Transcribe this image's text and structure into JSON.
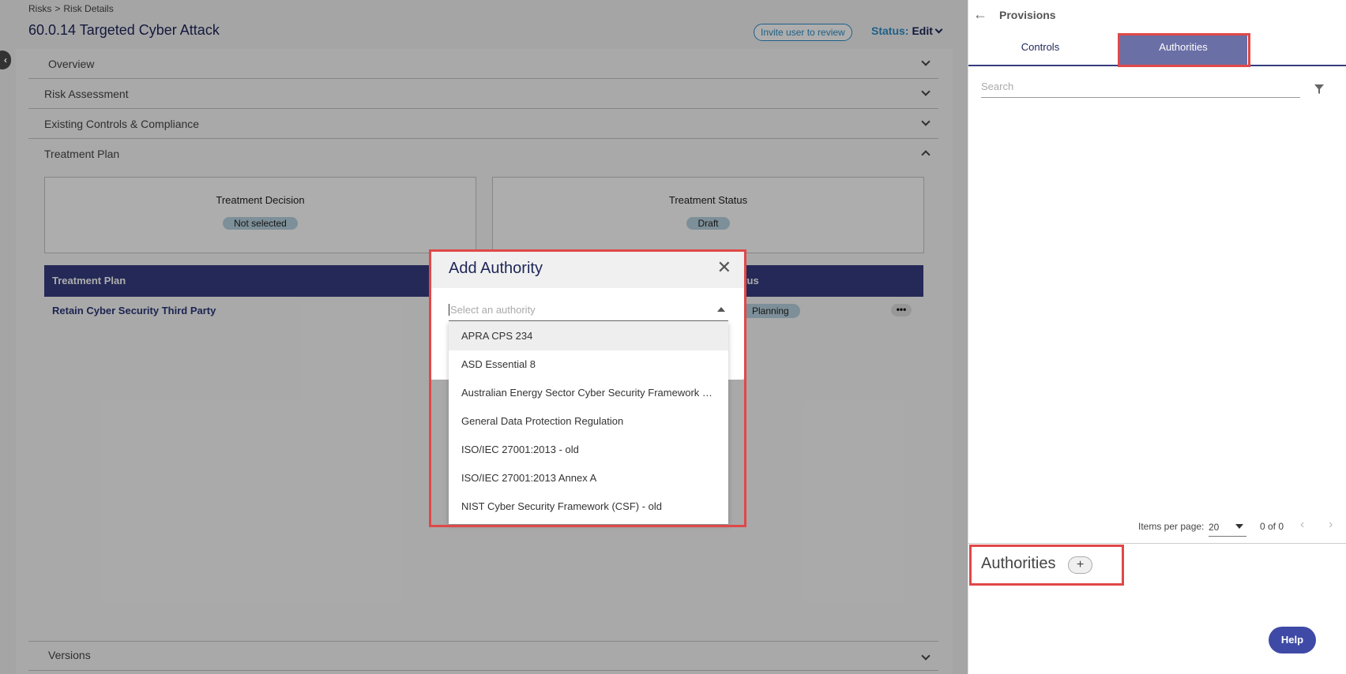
{
  "breadcrumb": {
    "root": "Risks",
    "separator": ">",
    "current": "Risk Details"
  },
  "page_title": "60.0.14 Targeted Cyber Attack",
  "invite_button": "Invite user to review",
  "status": {
    "label": "Status:",
    "value": "Edit"
  },
  "sections": {
    "overview": "Overview",
    "risk_assessment": "Risk Assessment",
    "existing_controls": "Existing Controls & Compliance",
    "treatment_plan": "Treatment Plan",
    "versions": "Versions"
  },
  "treatment_decision": {
    "title": "Treatment Decision",
    "value": "Not selected"
  },
  "treatment_status": {
    "title": "Treatment Status",
    "value": "Draft"
  },
  "table": {
    "headers": [
      "Treatment Plan",
      "Status"
    ],
    "visible_status_header": "atus",
    "rows": [
      {
        "plan": "Retain Cyber Security Third Party",
        "status": "Planning",
        "actions": "•••"
      }
    ]
  },
  "modal": {
    "title": "Add Authority",
    "close": "✕",
    "placeholder": "Select an authority",
    "options": [
      "APRA CPS 234",
      "ASD Essential 8",
      "Australian Energy Sector Cyber Security Framework (A...",
      "General Data Protection Regulation",
      "ISO/IEC 27001:2013 - old",
      "ISO/IEC 27001:2013 Annex A",
      "NIST Cyber Security Framework (CSF) - old"
    ]
  },
  "right_panel": {
    "back": "←",
    "title": "Provisions",
    "tabs": {
      "controls": "Controls",
      "authorities": "Authorities"
    },
    "search_placeholder": "Search",
    "pager": {
      "label": "Items per page:",
      "per_page": "20",
      "range": "0 of 0",
      "prev": "‹",
      "next": "›"
    },
    "authorities_heading": "Authorities",
    "add": "+"
  },
  "help_button": "Help",
  "collapse_handle": "‹",
  "colors": {
    "accent": "#363d80",
    "link": "#2d8fc7",
    "highlight": "#e04848",
    "pill": "#b8d3e0"
  }
}
